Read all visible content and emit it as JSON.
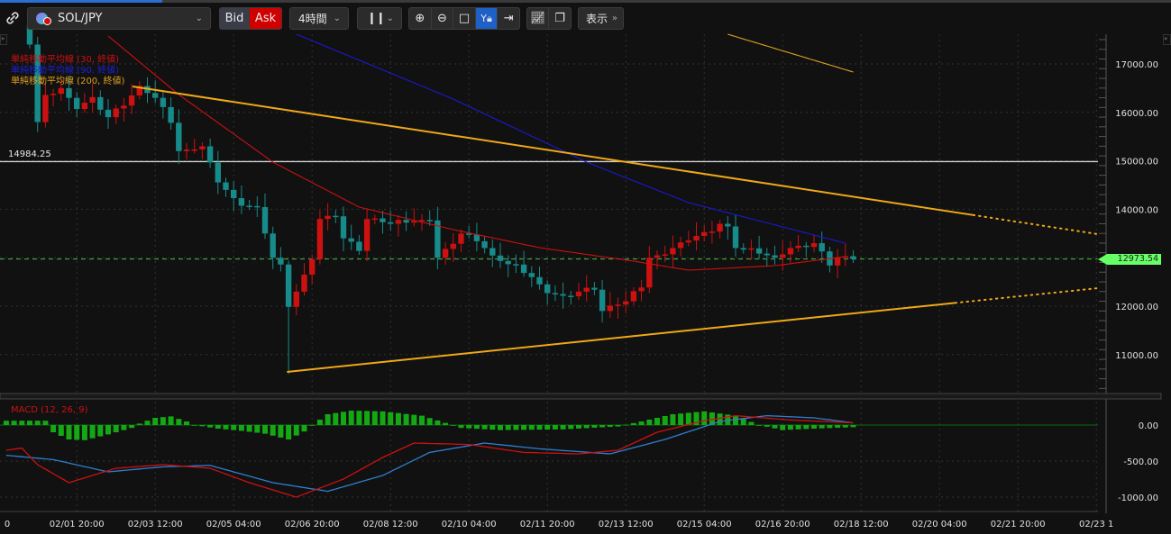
{
  "toolbar": {
    "symbol": "SOL/JPY",
    "bid_label": "Bid",
    "ask_label": "Ask",
    "timeframe": "4時間",
    "display_label": "表示"
  },
  "legend": {
    "sma30": "単純移動平均線 (30, 終値)",
    "sma90": "単純移動平均線 (90, 終値)",
    "sma200": "単純移動平均線 (200, 終値)",
    "macd": "MACD (12, 26, 9)"
  },
  "colors": {
    "bull": "#cc1111",
    "bear": "#178a8a",
    "sma30": "#cc1111",
    "sma90": "#1a1ad0",
    "sma200": "#e0a020",
    "trend": "#f0a818",
    "macd": "#cc1111",
    "signal": "#2e7fd0",
    "hist": "#14a814",
    "price": "#66ff66"
  },
  "hline_label": "14984.25",
  "current_price": "12973.54",
  "chart_data": {
    "type": "candlestick",
    "symbol": "SOL/JPY",
    "interval": "4h",
    "price_axis": {
      "ticks": [
        "17000.00",
        "16000.00",
        "15000.00",
        "14000.00",
        "13000.00",
        "12000.00",
        "11000.00"
      ],
      "range": [
        10200,
        17600
      ]
    },
    "macd_axis": {
      "ticks": [
        "0.00",
        "-500.00",
        "-1000.00"
      ],
      "range": [
        -1150,
        380
      ]
    },
    "x_ticks": [
      {
        "i": -4,
        "label": "0"
      },
      {
        "i": 6,
        "label": "02/01 20:00"
      },
      {
        "i": 16,
        "label": "02/03 12:00"
      },
      {
        "i": 26,
        "label": "02/05 04:00"
      },
      {
        "i": 36,
        "label": "02/06 20:00"
      },
      {
        "i": 46,
        "label": "02/08 12:00"
      },
      {
        "i": 56,
        "label": "02/10 04:00"
      },
      {
        "i": 66,
        "label": "02/11 20:00"
      },
      {
        "i": 76,
        "label": "02/13 12:00"
      },
      {
        "i": 86,
        "label": "02/15 04:00"
      },
      {
        "i": 96,
        "label": "02/16 20:00"
      },
      {
        "i": 106,
        "label": "02/18 12:00"
      },
      {
        "i": 116,
        "label": "02/20 04:00"
      },
      {
        "i": 126,
        "label": "02/21 20:00"
      },
      {
        "i": 136,
        "label": "02/23 1"
      }
    ],
    "close_anchors": [
      [
        0,
        17400
      ],
      [
        1,
        15800
      ],
      [
        2,
        16300
      ],
      [
        4,
        16500
      ],
      [
        6,
        16100
      ],
      [
        8,
        16300
      ],
      [
        10,
        15900
      ],
      [
        12,
        16200
      ],
      [
        14,
        16500
      ],
      [
        16,
        16300
      ],
      [
        18,
        15800
      ],
      [
        19,
        15200
      ],
      [
        22,
        15300
      ],
      [
        24,
        14600
      ],
      [
        26,
        14200
      ],
      [
        29,
        14000
      ],
      [
        31,
        13000
      ],
      [
        32,
        12800
      ],
      [
        33,
        12000
      ],
      [
        34,
        12300
      ],
      [
        36,
        13000
      ],
      [
        37,
        13800
      ],
      [
        39,
        13900
      ],
      [
        40,
        13400
      ],
      [
        42,
        13200
      ],
      [
        43,
        13800
      ],
      [
        46,
        13700
      ],
      [
        51,
        13800
      ],
      [
        52,
        13000
      ],
      [
        55,
        13500
      ],
      [
        57,
        13400
      ],
      [
        59,
        13000
      ],
      [
        62,
        12800
      ],
      [
        64,
        12600
      ],
      [
        66,
        12300
      ],
      [
        68,
        12200
      ],
      [
        72,
        12400
      ],
      [
        73,
        11900
      ],
      [
        76,
        12100
      ],
      [
        78,
        12400
      ],
      [
        79,
        13000
      ],
      [
        81,
        13100
      ],
      [
        84,
        13400
      ],
      [
        86,
        13500
      ],
      [
        88,
        13700
      ],
      [
        89,
        13600
      ],
      [
        90,
        13200
      ],
      [
        93,
        13100
      ],
      [
        95,
        13000
      ],
      [
        97,
        13200
      ],
      [
        100,
        13300
      ],
      [
        102,
        12900
      ],
      [
        103,
        13000
      ],
      [
        105,
        12974
      ]
    ],
    "spike_low": {
      "i": 33,
      "price": 10600
    },
    "sma30": [
      [
        10,
        17576
      ],
      [
        19,
        16368
      ],
      [
        31,
        14974
      ],
      [
        42,
        14045
      ],
      [
        54,
        13580
      ],
      [
        65,
        13208
      ],
      [
        77,
        12929
      ],
      [
        84,
        12743
      ],
      [
        95,
        12836
      ],
      [
        104,
        13022
      ]
    ],
    "sma90": [
      [
        34,
        17613
      ],
      [
        54,
        16275
      ],
      [
        71,
        14974
      ],
      [
        84,
        14138
      ],
      [
        104,
        13301
      ]
    ],
    "sma200": [
      [
        89,
        17613
      ],
      [
        105,
        16833
      ]
    ],
    "trend_upper": {
      "from": [
        13.1,
        16535
      ],
      "to": [
        136.2,
        13487
      ],
      "solid_until": 120.3
    },
    "trend_lower": {
      "from": [
        32.8,
        10643
      ],
      "to": [
        136.2,
        12372
      ],
      "solid_until": 118
    },
    "hline": 14984.25,
    "current": 12973.54,
    "macd": [
      [
        -3,
        -350
      ],
      [
        -1,
        -320
      ],
      [
        1,
        -550
      ],
      [
        5,
        -800
      ],
      [
        11,
        -600
      ],
      [
        17,
        -550
      ],
      [
        23,
        -600
      ],
      [
        28,
        -800
      ],
      [
        34,
        -1000
      ],
      [
        40,
        -750
      ],
      [
        45,
        -450
      ],
      [
        49,
        -250
      ],
      [
        56,
        -270
      ],
      [
        63,
        -380
      ],
      [
        70,
        -400
      ],
      [
        75,
        -350
      ],
      [
        80,
        -100
      ],
      [
        86,
        60
      ],
      [
        90,
        130
      ],
      [
        97,
        70
      ],
      [
        105,
        30
      ]
    ],
    "signal": [
      [
        -3,
        -420
      ],
      [
        3,
        -480
      ],
      [
        10,
        -650
      ],
      [
        17,
        -580
      ],
      [
        23,
        -560
      ],
      [
        31,
        -800
      ],
      [
        38,
        -920
      ],
      [
        45,
        -700
      ],
      [
        51,
        -380
      ],
      [
        58,
        -250
      ],
      [
        65,
        -330
      ],
      [
        74,
        -400
      ],
      [
        81,
        -200
      ],
      [
        88,
        50
      ],
      [
        94,
        130
      ],
      [
        100,
        100
      ],
      [
        105,
        30
      ]
    ],
    "histogram": [
      [
        -3,
        60
      ],
      [
        0,
        60
      ],
      [
        2,
        60
      ],
      [
        3,
        -100
      ],
      [
        5,
        -200
      ],
      [
        7,
        -210
      ],
      [
        10,
        -130
      ],
      [
        13,
        -40
      ],
      [
        14,
        20
      ],
      [
        16,
        100
      ],
      [
        18,
        120
      ],
      [
        20,
        50
      ],
      [
        21,
        0
      ],
      [
        24,
        -50
      ],
      [
        27,
        -80
      ],
      [
        30,
        -120
      ],
      [
        33,
        -200
      ],
      [
        35,
        -90
      ],
      [
        36,
        0
      ],
      [
        38,
        150
      ],
      [
        41,
        200
      ],
      [
        45,
        190
      ],
      [
        50,
        130
      ],
      [
        53,
        30
      ],
      [
        55,
        -40
      ],
      [
        60,
        -70
      ],
      [
        68,
        -60
      ],
      [
        75,
        -20
      ],
      [
        78,
        50
      ],
      [
        82,
        150
      ],
      [
        86,
        190
      ],
      [
        90,
        130
      ],
      [
        93,
        0
      ],
      [
        96,
        -70
      ],
      [
        100,
        -50
      ],
      [
        105,
        -30
      ]
    ]
  }
}
